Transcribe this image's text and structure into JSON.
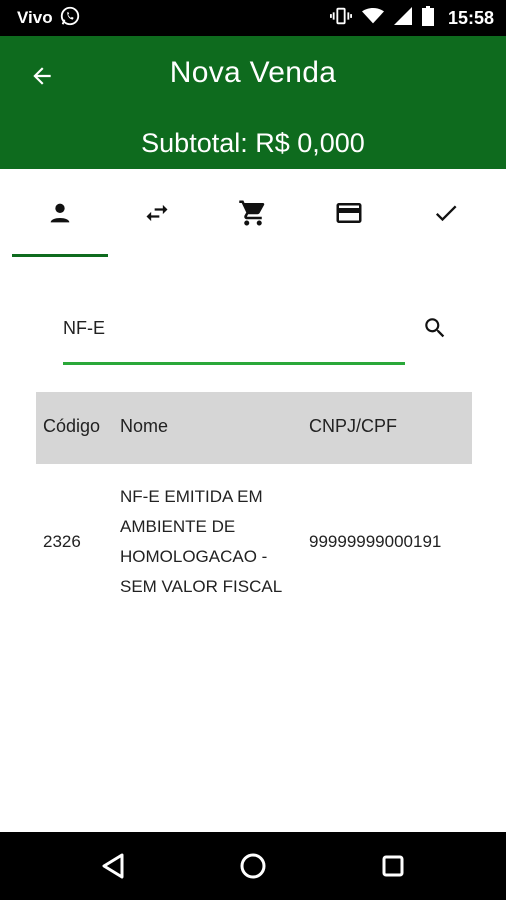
{
  "status_bar": {
    "carrier": "Vivo",
    "time": "15:58"
  },
  "app_bar": {
    "title": "Nova Venda",
    "subtotal": "Subtotal: R$ 0,000"
  },
  "tabs": [
    {
      "icon": "person-icon",
      "active": true
    },
    {
      "icon": "swap-arrows-icon",
      "active": false
    },
    {
      "icon": "shopping-cart-icon",
      "active": false
    },
    {
      "icon": "credit-card-icon",
      "active": false
    },
    {
      "icon": "check-icon",
      "active": false
    }
  ],
  "search": {
    "value": "NF-E"
  },
  "table": {
    "headers": [
      "Código",
      "Nome",
      "CNPJ/CPF"
    ],
    "rows": [
      {
        "codigo": "2326",
        "nome_lines": [
          "NF-E EMITIDA EM",
          "AMBIENTE DE",
          "HOMOLOGACAO -",
          "SEM VALOR FISCAL"
        ],
        "cnpj": "99999999000191"
      }
    ]
  },
  "colors": {
    "primary": "#0e6b1e",
    "accent": "#2aa839",
    "header_bg": "#d6d6d6"
  }
}
